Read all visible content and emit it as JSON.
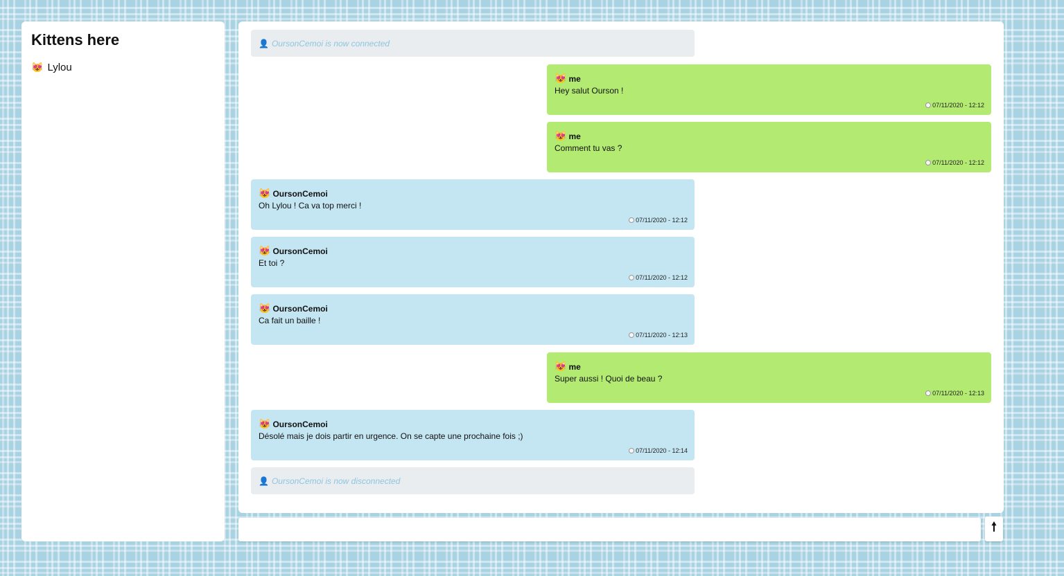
{
  "sidebar": {
    "title": "Kittens here",
    "users": [
      {
        "icon": "😻",
        "name": "Lylou"
      }
    ]
  },
  "chat": {
    "system_connected": {
      "icon": "👤",
      "text": "OursonCemoi is now connected"
    },
    "messages": [
      {
        "icon": "😻",
        "author": "me",
        "text": "Hey salut Ourson !",
        "time": "07/11/2020 - 12:12"
      },
      {
        "icon": "😻",
        "author": "me",
        "text": "Comment tu vas ?",
        "time": "07/11/2020 - 12:12"
      },
      {
        "icon": "😻",
        "author": "OursonCemoi",
        "text": "Oh Lylou ! Ca va top merci !",
        "time": "07/11/2020 - 12:12"
      },
      {
        "icon": "😻",
        "author": "OursonCemoi",
        "text": "Et toi ?",
        "time": "07/11/2020 - 12:12"
      },
      {
        "icon": "😻",
        "author": "OursonCemoi",
        "text": "Ca fait un baille !",
        "time": "07/11/2020 - 12:13"
      },
      {
        "icon": "😻",
        "author": "me",
        "text": "Super aussi ! Quoi de beau ?",
        "time": "07/11/2020 - 12:13"
      },
      {
        "icon": "😻",
        "author": "OursonCemoi",
        "text": "Désolé mais je dois partir en urgence. On se capte une prochaine fois ;)",
        "time": "07/11/2020 - 12:14"
      }
    ],
    "system_disconnected": {
      "icon": "👤",
      "text": "OursonCemoi is now disconnected"
    }
  },
  "composer": {
    "value": "",
    "send_label": "🠕"
  },
  "colors": {
    "mine_bubble": "#b3ea72",
    "other_bubble": "#c4e5f2",
    "system_bubble": "#e9edf0",
    "system_text": "#8cc6e0"
  },
  "icons": {
    "user_emoji": "smiling-cat-heart-eyes-icon",
    "clock": "clock-icon",
    "system": "user-silhouette-icon",
    "send": "arrow-up-icon"
  }
}
